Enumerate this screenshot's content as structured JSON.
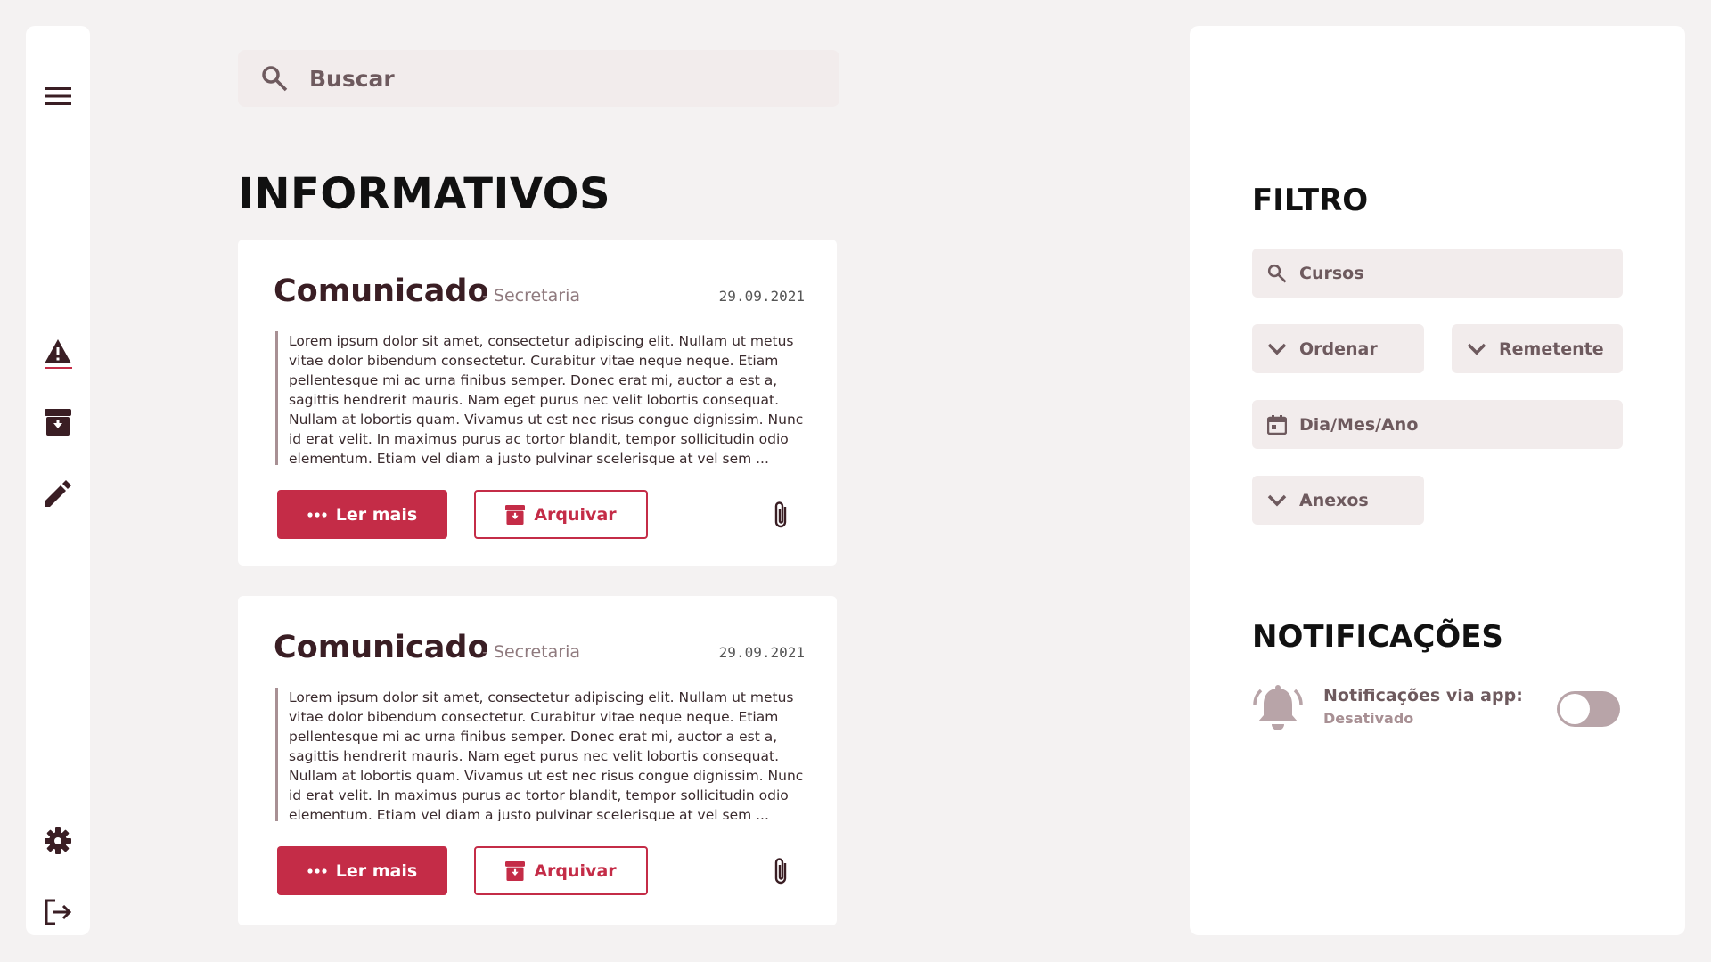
{
  "search": {
    "placeholder": "Buscar"
  },
  "page": {
    "title": "INFORMATIVOS"
  },
  "cards": [
    {
      "title": "Comunicado",
      "sender": "- Secretaria",
      "date": "29.09.2021",
      "body": "Lorem ipsum dolor sit amet, consectetur adipiscing elit. Nullam ut metus vitae dolor bibendum consectetur. Curabitur vitae neque neque. Etiam pellentesque mi ac urna finibus semper. Donec erat mi, auctor a est a, sagittis hendrerit mauris. Nam eget purus nec velit lobortis consequat. Nullam at lobortis quam. Vivamus ut est nec risus congue dignissim. Nunc id erat velit. In maximus purus ac tortor blandit, tempor sollicitudin odio elementum. Etiam vel diam a justo pulvinar scelerisque at vel sem ...",
      "read_more": "Ler mais",
      "archive": "Arquivar"
    },
    {
      "title": "Comunicado",
      "sender": "- Secretaria",
      "date": "29.09.2021",
      "body": "Lorem ipsum dolor sit amet, consectetur adipiscing elit. Nullam ut metus vitae dolor bibendum consectetur. Curabitur vitae neque neque. Etiam pellentesque mi ac urna finibus semper. Donec erat mi, auctor a est a, sagittis hendrerit mauris. Nam eget purus nec velit lobortis consequat. Nullam at lobortis quam. Vivamus ut est nec risus congue dignissim. Nunc id erat velit. In maximus purus ac tortor blandit, tempor sollicitudin odio elementum. Etiam vel diam a justo pulvinar scelerisque at vel sem ...",
      "read_more": "Ler mais",
      "archive": "Arquivar"
    }
  ],
  "filter": {
    "title": "FILTRO",
    "courses": "Cursos",
    "order": "Ordenar",
    "sender": "Remetente",
    "date": "Dia/Mes/Ano",
    "attachments": "Anexos"
  },
  "notifications": {
    "title": "NOTIFICAÇÕES",
    "label": "Notificações via app:",
    "state": "Desativado",
    "enabled": false
  },
  "sidebar": {
    "icons": [
      "menu-icon",
      "warning-icon",
      "archive-icon",
      "pencil-icon",
      "gear-icon",
      "logout-icon"
    ]
  },
  "colors": {
    "accent": "#c42c47",
    "text_dark": "#3a1e24",
    "muted": "#6e5a5e",
    "field_bg": "#f2ecec",
    "page_bg": "#f4f2f2"
  }
}
